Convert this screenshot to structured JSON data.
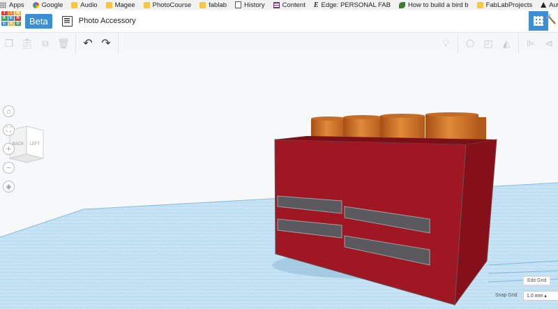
{
  "bookmarks": [
    {
      "label": "Apps",
      "icon": "apps-icon"
    },
    {
      "label": "Google",
      "icon": "google-icon"
    },
    {
      "label": "Audio",
      "icon": "folder-icon"
    },
    {
      "label": "Magee",
      "icon": "folder-icon"
    },
    {
      "label": "PhotoCourse",
      "icon": "folder-icon"
    },
    {
      "label": "fablab",
      "icon": "folder-icon"
    },
    {
      "label": "History",
      "icon": "page-icon"
    },
    {
      "label": "Content",
      "icon": "grid-icon"
    },
    {
      "label": "Edge: PERSONAL FAB",
      "icon": "edge-icon"
    },
    {
      "label": "How to build a bird b",
      "icon": "leaf-icon"
    },
    {
      "label": "FabLabProjects",
      "icon": "folder-icon"
    },
    {
      "label": "Autodesk Digital",
      "icon": "autodesk-icon"
    }
  ],
  "header": {
    "logo_letters": [
      "T",
      "I",
      "N",
      "K",
      "E",
      "R",
      "C",
      "A",
      "D"
    ],
    "beta_label": "Beta",
    "project_title": "Photo Accessory"
  },
  "viewcube": {
    "back_label": "BACK",
    "left_label": "LEFT"
  },
  "grid_controls": {
    "edit_grid_label": "Edit Grid",
    "snap_grid_label": "Snap Grid",
    "snap_value": "1.0 mm ▴"
  },
  "colors": {
    "accent": "#3c8fd6",
    "box_red": "#9e1722",
    "cylinder_orange": "#d8792a",
    "grid_blue": "#a8d4ec"
  }
}
